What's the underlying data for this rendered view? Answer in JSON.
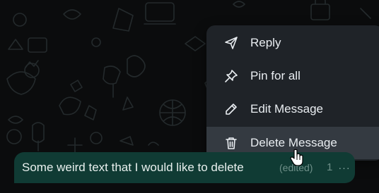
{
  "context_menu": {
    "items": [
      {
        "label": "Reply",
        "icon": "reply-icon"
      },
      {
        "label": "Pin for all",
        "icon": "pin-icon"
      },
      {
        "label": "Edit Message",
        "icon": "pencil-icon"
      },
      {
        "label": "Delete Message",
        "icon": "trash-icon"
      }
    ],
    "hovered_index": 3
  },
  "message": {
    "text": "Some weird text that I would like to delete",
    "edited_label": "(edited)",
    "time_fragment": "1",
    "more_label": "···"
  },
  "colors": {
    "background": "#0b0c0d",
    "menu_bg": "#1f2328",
    "menu_hover": "#343a41",
    "bubble_bg": "#103b34",
    "text": "#e9edf1"
  }
}
